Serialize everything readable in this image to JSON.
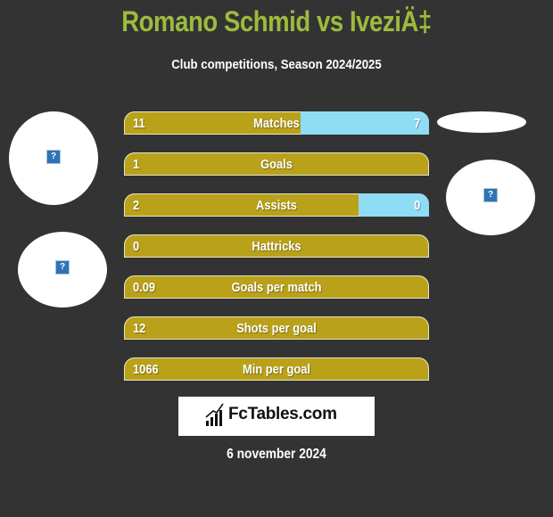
{
  "header": {
    "title": "Romano Schmid vs IveziÄ‡",
    "subtitle": "Club competitions, Season 2024/2025"
  },
  "colors": {
    "left": "#b9a11a",
    "right": "#8fdcf5",
    "title": "#9dbb3c",
    "background": "#333333"
  },
  "stats": [
    {
      "label": "Matches",
      "left": "11",
      "right": "7",
      "left_fill": 0.58
    },
    {
      "label": "Goals",
      "left": "1",
      "right": "",
      "left_fill": 1.0
    },
    {
      "label": "Assists",
      "left": "2",
      "right": "0",
      "left_fill": 0.77
    },
    {
      "label": "Hattricks",
      "left": "0",
      "right": "",
      "left_fill": 1.0
    },
    {
      "label": "Goals per match",
      "left": "0.09",
      "right": "",
      "left_fill": 1.0
    },
    {
      "label": "Shots per goal",
      "left": "12",
      "right": "",
      "left_fill": 1.0
    },
    {
      "label": "Min per goal",
      "left": "1066",
      "right": "",
      "left_fill": 1.0
    }
  ],
  "images": {
    "placeholder_icon": "?"
  },
  "footer": {
    "brand": "FcTables.com",
    "date": "6 november 2024"
  }
}
